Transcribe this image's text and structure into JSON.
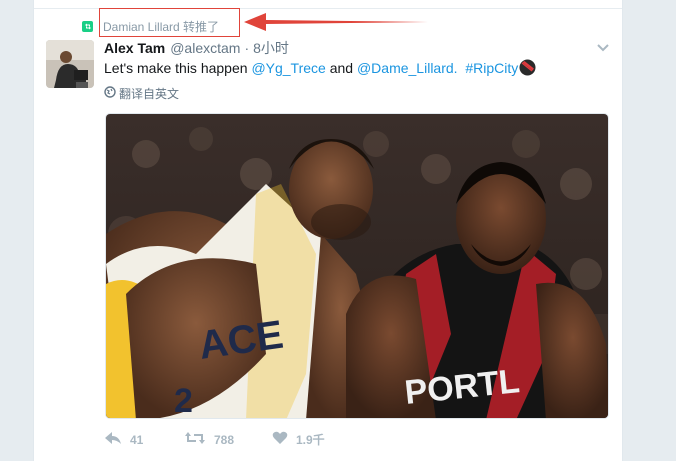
{
  "retweet": {
    "label": "Damian Lillard 转推了"
  },
  "tweet": {
    "author_name": "Alex Tam",
    "handle": "@alexctam",
    "separator": "·",
    "time": "8小时",
    "text_prefix": "Let's make this happen ",
    "mention_1": "@Yg_Trece",
    "text_and": " and ",
    "mention_2": "@Dame_Lillard.",
    "hashtag": "#RipCity",
    "translate_label": "翻译自英文"
  },
  "actions": {
    "reply_count": "41",
    "retweet_count": "788",
    "like_count": "1.9千"
  },
  "media": {
    "left_jersey_text": "ACE",
    "left_jersey_number": "2",
    "right_jersey_text": "PORTL"
  },
  "colors": {
    "link": "#1b95e0",
    "retweet_green": "#19cf86",
    "highlight_red": "#e0443a",
    "muted": "#657786"
  },
  "icons": [
    "retweet-badge-icon",
    "caret-down-icon",
    "globe-icon",
    "reply-icon",
    "retweet-icon",
    "heart-icon",
    "blazers-pinwheel-icon"
  ]
}
